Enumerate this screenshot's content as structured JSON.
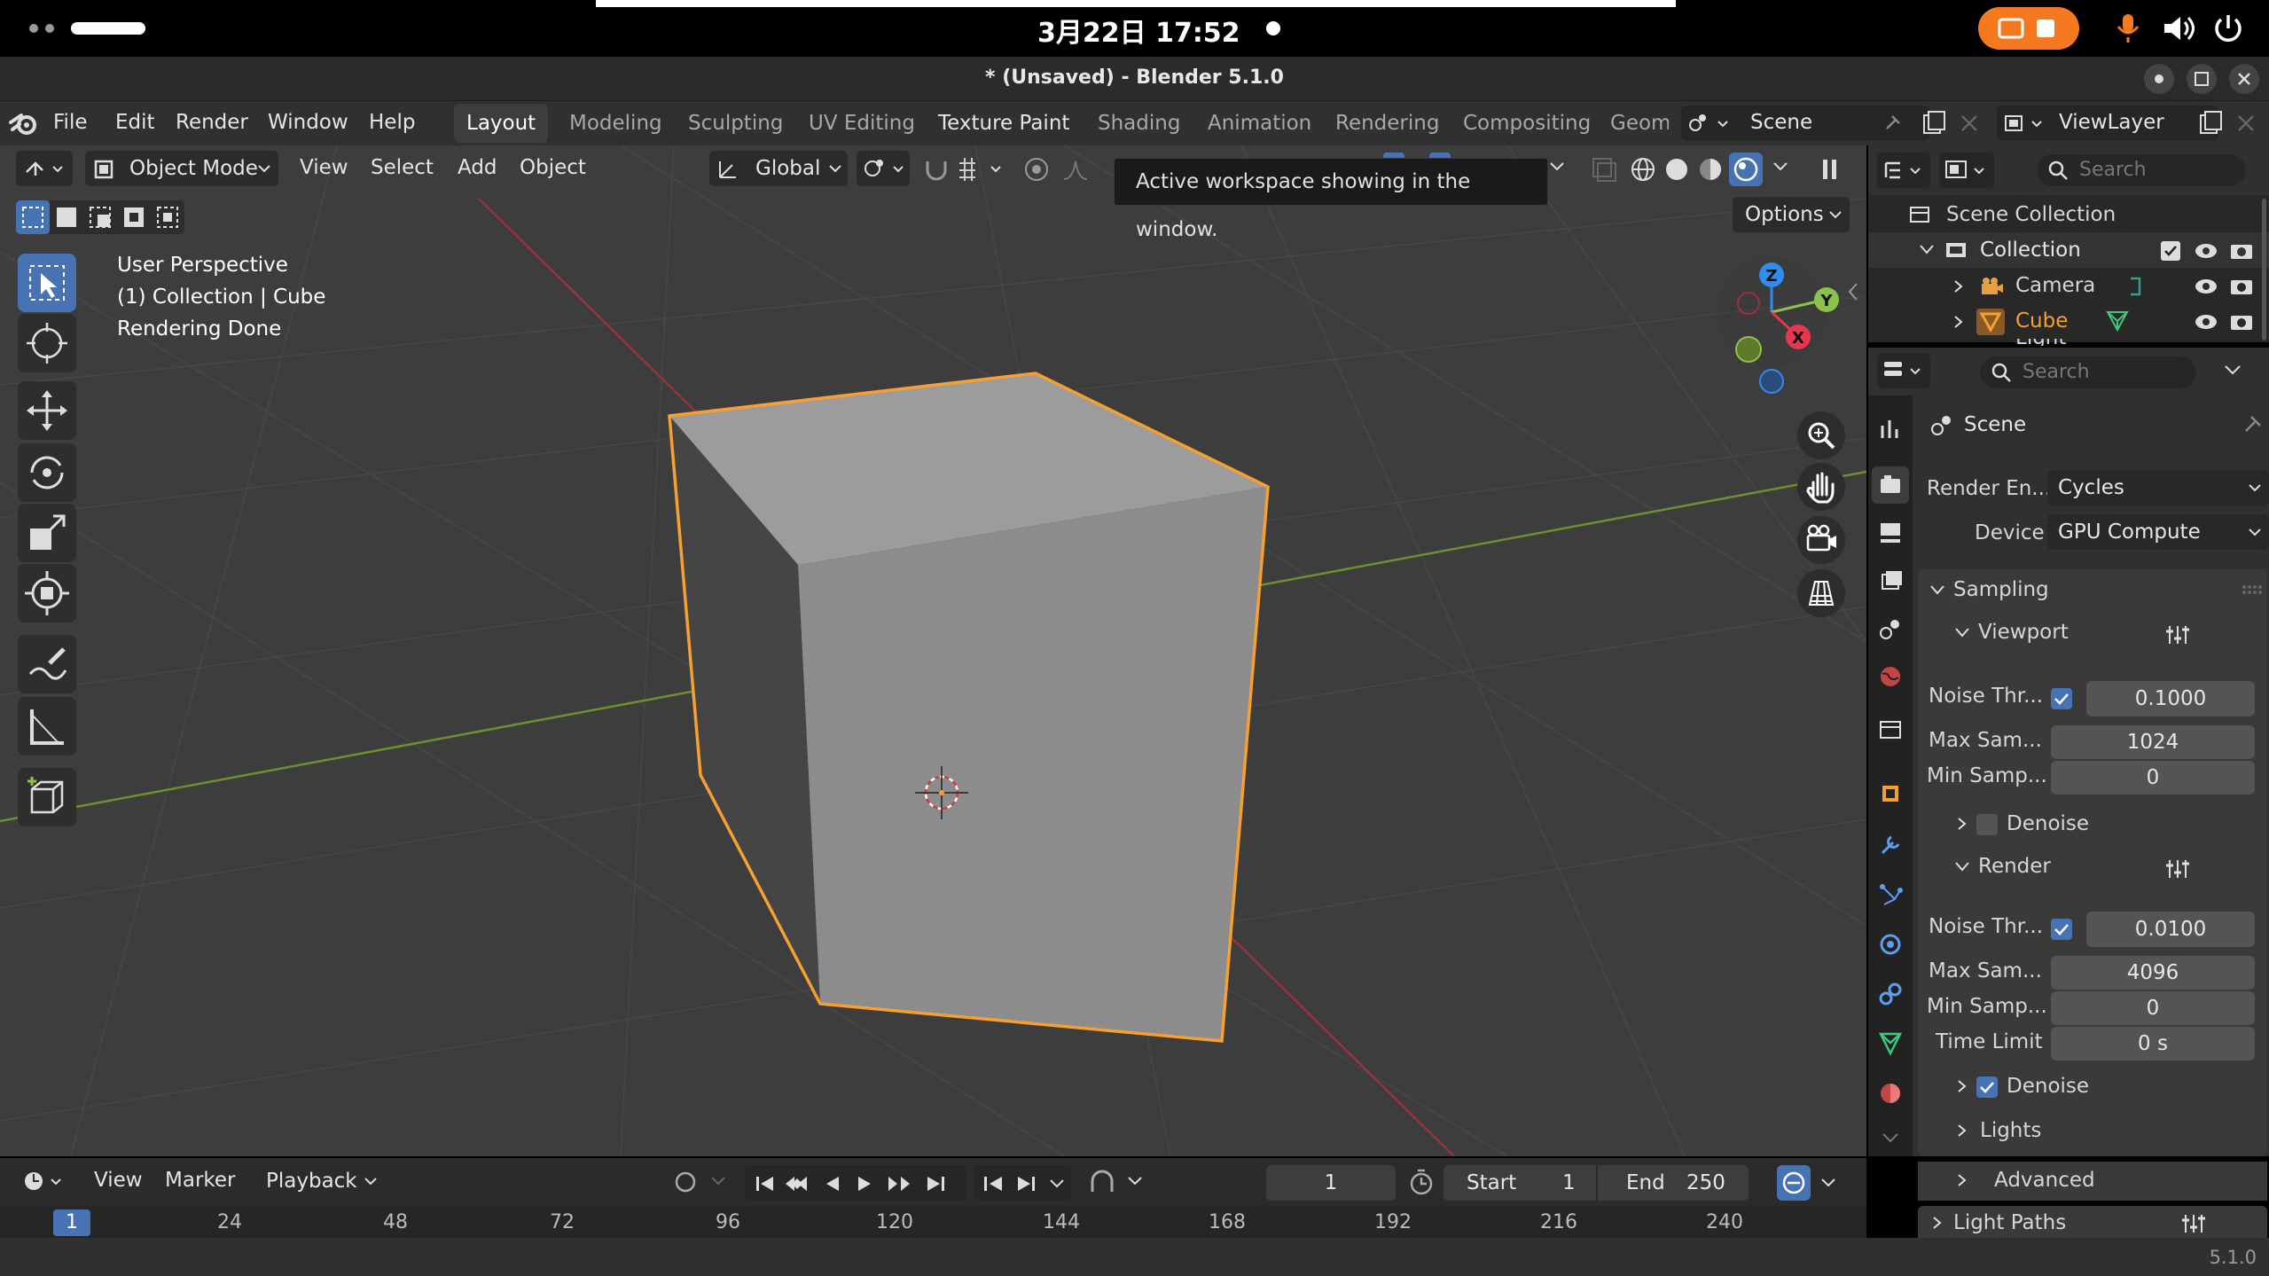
{
  "status_bar": {
    "date_time": "3月22日 17:52"
  },
  "window": {
    "title": "* (Unsaved) - Blender 5.1.0"
  },
  "menu": {
    "items": [
      "File",
      "Edit",
      "Render",
      "Window",
      "Help"
    ]
  },
  "workspaces": [
    "Layout",
    "Modeling",
    "Sculpting",
    "UV Editing",
    "Texture Paint",
    "Shading",
    "Animation",
    "Rendering",
    "Compositing",
    "Geom"
  ],
  "scene_selector": {
    "scene": "Scene",
    "view_layer": "ViewLayer"
  },
  "viewport_header": {
    "mode": "Object Mode",
    "menus": [
      "View",
      "Select",
      "Add",
      "Object"
    ],
    "orientation": "Global",
    "options": "Options"
  },
  "tooltip": {
    "text": "Active workspace showing in the window."
  },
  "viewport_info": {
    "line1": "User Perspective",
    "line2": "(1) Collection | Cube",
    "line3": "Rendering Done"
  },
  "gizmo": {
    "x": "X",
    "y": "Y",
    "z": "Z"
  },
  "outliner": {
    "search_placeholder": "Search",
    "scene_collection": "Scene Collection",
    "collection": "Collection",
    "items": [
      "Camera",
      "Cube",
      "Light"
    ]
  },
  "properties": {
    "search_placeholder": "Search",
    "context": "Scene",
    "render_engine_label": "Render En...",
    "render_engine": "Cycles",
    "device_label": "Device",
    "device": "GPU Compute",
    "sampling": "Sampling",
    "viewport": {
      "title": "Viewport",
      "noise_label": "Noise Thr...",
      "noise": "0.1000",
      "max_label": "Max Sam...",
      "max": "1024",
      "min_label": "Min Samp...",
      "min": "0",
      "denoise": "Denoise"
    },
    "render": {
      "title": "Render",
      "noise_label": "Noise Thr...",
      "noise": "0.0100",
      "max_label": "Max Sam...",
      "max": "4096",
      "min_label": "Min Samp...",
      "min": "0",
      "time_label": "Time Limit",
      "time": "0 s",
      "denoise": "Denoise"
    },
    "lights": "Lights",
    "advanced": "Advanced",
    "light_paths": "Light Paths"
  },
  "timeline": {
    "menus": [
      "View",
      "Marker",
      "Playback"
    ],
    "current_frame": "1",
    "start_label": "Start",
    "start": "1",
    "end_label": "End",
    "end": "250",
    "ruler": [
      "1",
      "24",
      "48",
      "72",
      "96",
      "120",
      "144",
      "168",
      "192",
      "216",
      "240"
    ]
  },
  "footer": {
    "version": "5.1.0"
  },
  "colors": {
    "accent": "#4772b3",
    "selection_outline": "#f5a030",
    "x_axis": "#e8364e",
    "y_axis": "#8bc34a",
    "z_axis": "#2f8cf0"
  }
}
